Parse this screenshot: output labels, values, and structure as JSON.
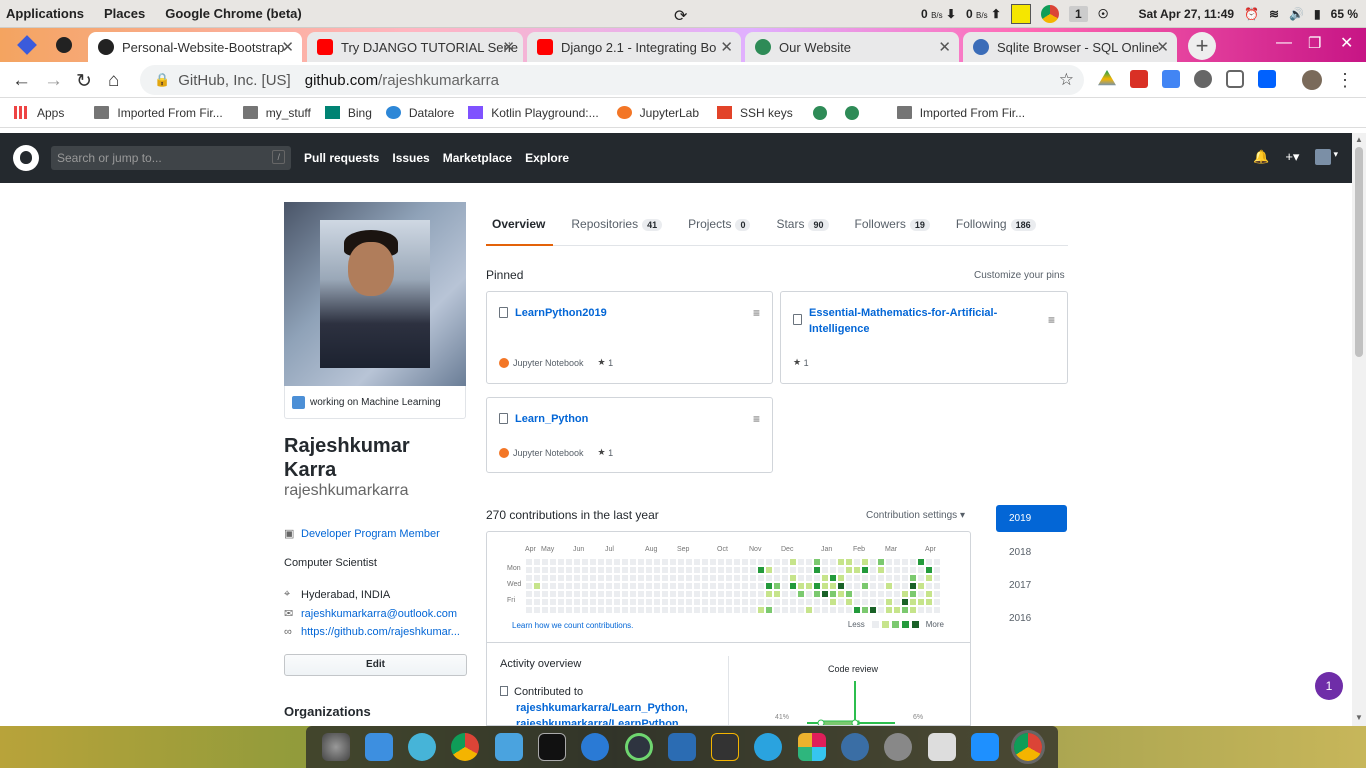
{
  "system": {
    "menus": [
      "Applications",
      "Places",
      "Google Chrome (beta)"
    ],
    "net_down": "0",
    "net_up": "0",
    "net_unit": "B/s",
    "workspace": "1",
    "datetime": "Sat Apr 27, 11:49",
    "battery": "65 %"
  },
  "tabs": [
    {
      "title": "Personal-Website-Bootstrap",
      "favicon": "github-icon",
      "color": "#222222"
    },
    {
      "title": "Try DJANGO TUTORIAL Serie",
      "favicon": "youtube-icon",
      "color": "#ff0000"
    },
    {
      "title": "Django 2.1 - Integrating Bo",
      "favicon": "youtube-icon",
      "color": "#ff0000"
    },
    {
      "title": "Our Website",
      "favicon": "globe-icon",
      "color": "#2e8b57"
    },
    {
      "title": "Sqlite Browser - SQL Online",
      "favicon": "sql-icon",
      "color": "#3b6cb8"
    }
  ],
  "address": {
    "org": "GitHub, Inc. [US]",
    "domain": "github.com",
    "path": "/rajeshkumarkarra"
  },
  "bookmarks": [
    {
      "label": "Apps",
      "icon": "apps-grid-icon"
    },
    {
      "label": "Imported From Fir...",
      "icon": "folder-icon"
    },
    {
      "label": "my_stuff",
      "icon": "folder-icon"
    },
    {
      "label": "Bing",
      "icon": "bing-icon"
    },
    {
      "label": "Datalore",
      "icon": "datalore-icon"
    },
    {
      "label": "Kotlin Playground:...",
      "icon": "kotlin-icon"
    },
    {
      "label": "JupyterLab",
      "icon": "jupyter-icon"
    },
    {
      "label": "SSH keys",
      "icon": "ssh-icon"
    },
    {
      "label": "Imported From Fir...",
      "icon": "folder-icon"
    }
  ],
  "github": {
    "search_placeholder": "Search or jump to...",
    "slash": "/",
    "nav": [
      "Pull requests",
      "Issues",
      "Marketplace",
      "Explore"
    ]
  },
  "profile": {
    "status": "working on Machine Learning",
    "name": "Rajeshkumar Karra",
    "username": "rajeshkumarkarra",
    "badge": "Developer Program Member",
    "bio": "Computer Scientist",
    "location": "Hyderabad, INDIA",
    "email": "rajeshkumarkarra@outlook.com",
    "website": "https://github.com/rajeshkumar...",
    "edit_label": "Edit",
    "orgs_heading": "Organizations"
  },
  "profile_tabs": [
    {
      "label": "Overview",
      "count": ""
    },
    {
      "label": "Repositories",
      "count": "41"
    },
    {
      "label": "Projects",
      "count": "0"
    },
    {
      "label": "Stars",
      "count": "90"
    },
    {
      "label": "Followers",
      "count": "19"
    },
    {
      "label": "Following",
      "count": "186"
    }
  ],
  "pinned": {
    "heading": "Pinned",
    "customize": "Customize your pins",
    "repos": [
      {
        "name": "LearnPython2019",
        "language": "Jupyter Notebook",
        "stars": "1"
      },
      {
        "name": "Essential-Mathematics-for-Artificial-Intelligence",
        "language": "",
        "stars": "1"
      },
      {
        "name": "Learn_Python",
        "language": "Jupyter Notebook",
        "stars": "1"
      }
    ]
  },
  "contributions": {
    "heading": "270 contributions in the last year",
    "settings": "Contribution settings",
    "months": [
      "Apr",
      "May",
      "Jun",
      "Jul",
      "Aug",
      "Sep",
      "Oct",
      "Nov",
      "Dec",
      "Jan",
      "Feb",
      "Mar",
      "Apr"
    ],
    "days": [
      "Mon",
      "Wed",
      "Fri"
    ],
    "howto": "Learn how we count contributions.",
    "less": "Less",
    "more": "More",
    "years": [
      "2019",
      "2018",
      "2017",
      "2016"
    ],
    "colors": [
      "#ebedf0",
      "#c6e48b",
      "#7bc96f",
      "#239a3b",
      "#196127"
    ]
  },
  "activity": {
    "heading": "Activity overview",
    "contributed_to": "Contributed to",
    "repo1": "rajeshkumarkarra/Learn_Python,",
    "repo2": "rajeshkumarkarra/LearnPython...",
    "code_review": "Code review",
    "pct_left": "41%",
    "pct_right": "6%"
  },
  "notification_badge": "1"
}
